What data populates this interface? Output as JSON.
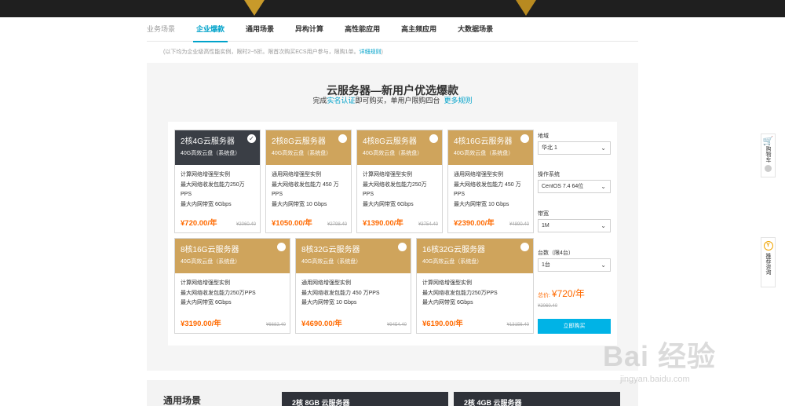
{
  "tabs": [
    {
      "label": "业务场景",
      "state": "muted"
    },
    {
      "label": "企业爆款",
      "state": "active"
    },
    {
      "label": "通用场景",
      "state": ""
    },
    {
      "label": "异构计算",
      "state": ""
    },
    {
      "label": "高性能应用",
      "state": ""
    },
    {
      "label": "高主频应用",
      "state": ""
    },
    {
      "label": "大数据场景",
      "state": ""
    }
  ],
  "notice": {
    "text": "(以下均为企业级高性能实例，限时2~5折。限首次购买ECS用户参与，限购1单。",
    "link": "详细规则",
    "tail": ")"
  },
  "section": {
    "title": "云服务器—新用户优选爆款",
    "subtitle_prefix": "完成",
    "subtitle_link1": "实名认证",
    "subtitle_mid": "即可购买，单用户限购四台",
    "subtitle_link2": "更多规则"
  },
  "cards": [
    {
      "title": "2核4G云服务器",
      "disk": "40G高效云盘（系统盘）",
      "spec1": "计算网络增强型实例",
      "spec2": "最大网络收发包能力250万PPS",
      "spec3": "最大内网带宽 6Gbps",
      "price": "¥720.00/年",
      "orig": "¥2060.40",
      "selected": true
    },
    {
      "title": "2核8G云服务器",
      "disk": "40G高效云盘（系统盘）",
      "spec1": "通用网络增强型实例",
      "spec2": "最大网络收发包能力 450 万PPS",
      "spec3": "最大内网带宽 10 Gbps",
      "price": "¥1050.00/年",
      "orig": "¥2798.40",
      "selected": false
    },
    {
      "title": "4核8G云服务器",
      "disk": "40G高效云盘（系统盘）",
      "spec1": "计算网络增强型实例",
      "spec2": "最大网络收发包能力250万PPS",
      "spec3": "最大内网带宽 6Gbps",
      "price": "¥1390.00/年",
      "orig": "¥3754.40",
      "selected": false
    },
    {
      "title": "4核16G云服务器",
      "disk": "40G高效云盘（系统盘）",
      "spec1": "通用网络增强型实例",
      "spec2": "最大网络收发包能力 450 万PPS",
      "spec3": "最大内网带宽 10 Gbps",
      "price": "¥2390.00/年",
      "orig": "¥4890.40",
      "selected": false
    },
    {
      "title": "8核16G云服务器",
      "disk": "40G高效云盘（系统盘）",
      "spec1": "计算网络增强型实例",
      "spec2": "最大网络收发包能力250万PPS",
      "spec3": "最大内网带宽 6Gbps",
      "price": "¥3190.00/年",
      "orig": "¥6682.40",
      "selected": false
    },
    {
      "title": "8核32G云服务器",
      "disk": "40G高效云盘（系统盘）",
      "spec1": "通用网络增强型实例",
      "spec2": "最大网络收发包能力 450 万PPS",
      "spec3": "最大内网带宽 10 Gbps",
      "price": "¥4690.00/年",
      "orig": "¥9454.40",
      "selected": false
    },
    {
      "title": "16核32G云服务器",
      "disk": "40G高效云盘（系统盘）",
      "spec1": "计算网络增强型实例",
      "spec2": "最大网络收发包能力250万PPS",
      "spec3": "最大内网带宽 6Gbps",
      "price": "¥6190.00/年",
      "orig": "¥13156.40",
      "selected": false
    }
  ],
  "side": {
    "region_label": "地域",
    "region_value": "华北 1",
    "os_label": "操作系统",
    "os_value": "CentOS 7.4 64位",
    "bw_label": "带宽",
    "bw_value": "1M",
    "qty_label": "台数（限4台）",
    "qty_value": "1台",
    "total_label": "总价:",
    "total_price": "¥720/年",
    "total_orig": "¥2060.40",
    "buy_label": "立即购买"
  },
  "float": {
    "cart_label": "购物车",
    "recommend_label": "推荐咨询",
    "recommend_badge": "Y"
  },
  "bottom": {
    "title": "通用场景",
    "card1": "2核 8GB 云服务器",
    "card2": "2核 4GB 云服务器"
  },
  "watermark": {
    "main": "Bai 经验",
    "sub": "jingyan.baidu.com"
  }
}
